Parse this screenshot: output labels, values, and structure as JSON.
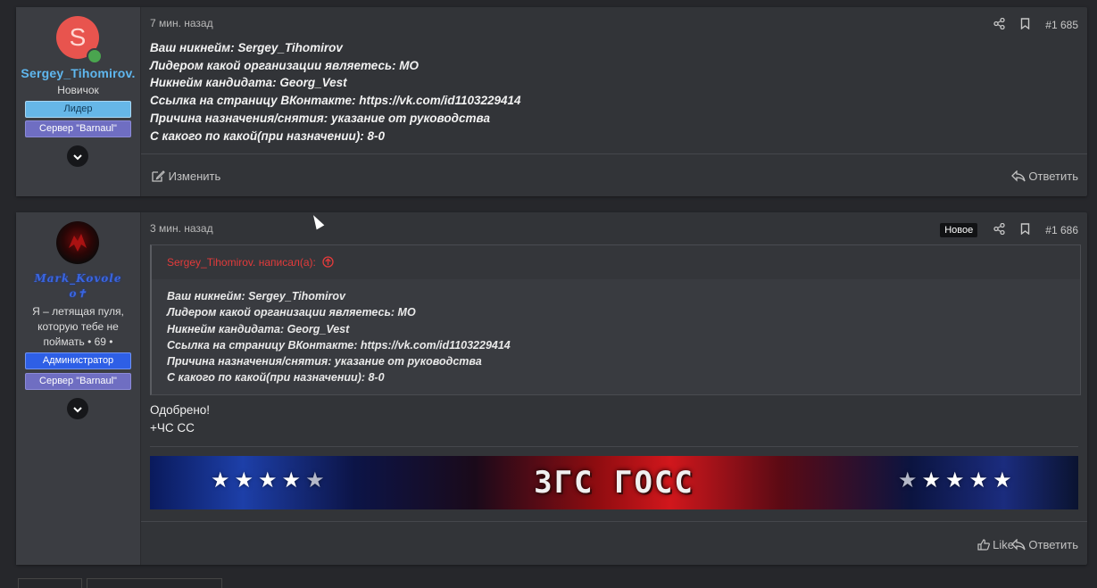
{
  "posts": [
    {
      "author": {
        "avatar_letter": "S",
        "name": "Sergey_Tihomirov.",
        "title": "Новичок",
        "badges": [
          "Лидер",
          "Сервер \"Barnaul\""
        ]
      },
      "time": "7 мин. назад",
      "number": "#1 685",
      "lines": [
        "Ваш никнейм: Sergey_Tihomirov",
        "Лидером какой организации являетесь: МО",
        "Никнейм кандидата: Georg_Vest",
        "Ссылка на страницу ВКонтакте: https://vk.com/id1103229414",
        "Причина назначения/снятия: указание от руководства",
        "С какого по какой(при назначении): 8-0"
      ],
      "footer": {
        "edit": "Изменить",
        "reply": "Ответить"
      }
    },
    {
      "author": {
        "name_line1": "Mark_Kovole",
        "name_line2": "o✝",
        "title_lines": [
          "Я – летящая пуля,",
          "которую тебе не",
          "поймать • 69 •"
        ],
        "badges": [
          "Администратор",
          "Сервер \"Barnaul\""
        ]
      },
      "time": "3 мин. назад",
      "new_label": "Новое",
      "number": "#1 686",
      "quote": {
        "header": "Sergey_Tihomirov. написал(а):",
        "lines": [
          "Ваш никнейм: Sergey_Tihomirov",
          "Лидером какой организации являетесь: МО",
          "Никнейм кандидата: Georg_Vest",
          "Ссылка на страницу ВКонтакте: https://vk.com/id1103229414",
          "Причина назначения/снятия: указание от руководства",
          "С какого по какой(при назначении): 8-0"
        ]
      },
      "reply_lines": [
        "Одобрено!",
        "+ЧС СС"
      ],
      "banner": {
        "title": "ЗГС ГОСС"
      },
      "footer": {
        "like": "Like",
        "reply": "Ответить"
      }
    }
  ],
  "colors": {
    "page_bg": "#26272b",
    "post_bg": "#323438",
    "user_col_bg": "#3b3d42",
    "username_blue": "#5fb7ef",
    "admin_name": "#3a66e0",
    "quote_author": "#e23b3b"
  },
  "icons": [
    "share-icon",
    "bookmark-icon",
    "edit-icon",
    "reply-icon",
    "like-icon",
    "chevron-down-icon",
    "online-icon",
    "arrow-up-circle-icon"
  ]
}
